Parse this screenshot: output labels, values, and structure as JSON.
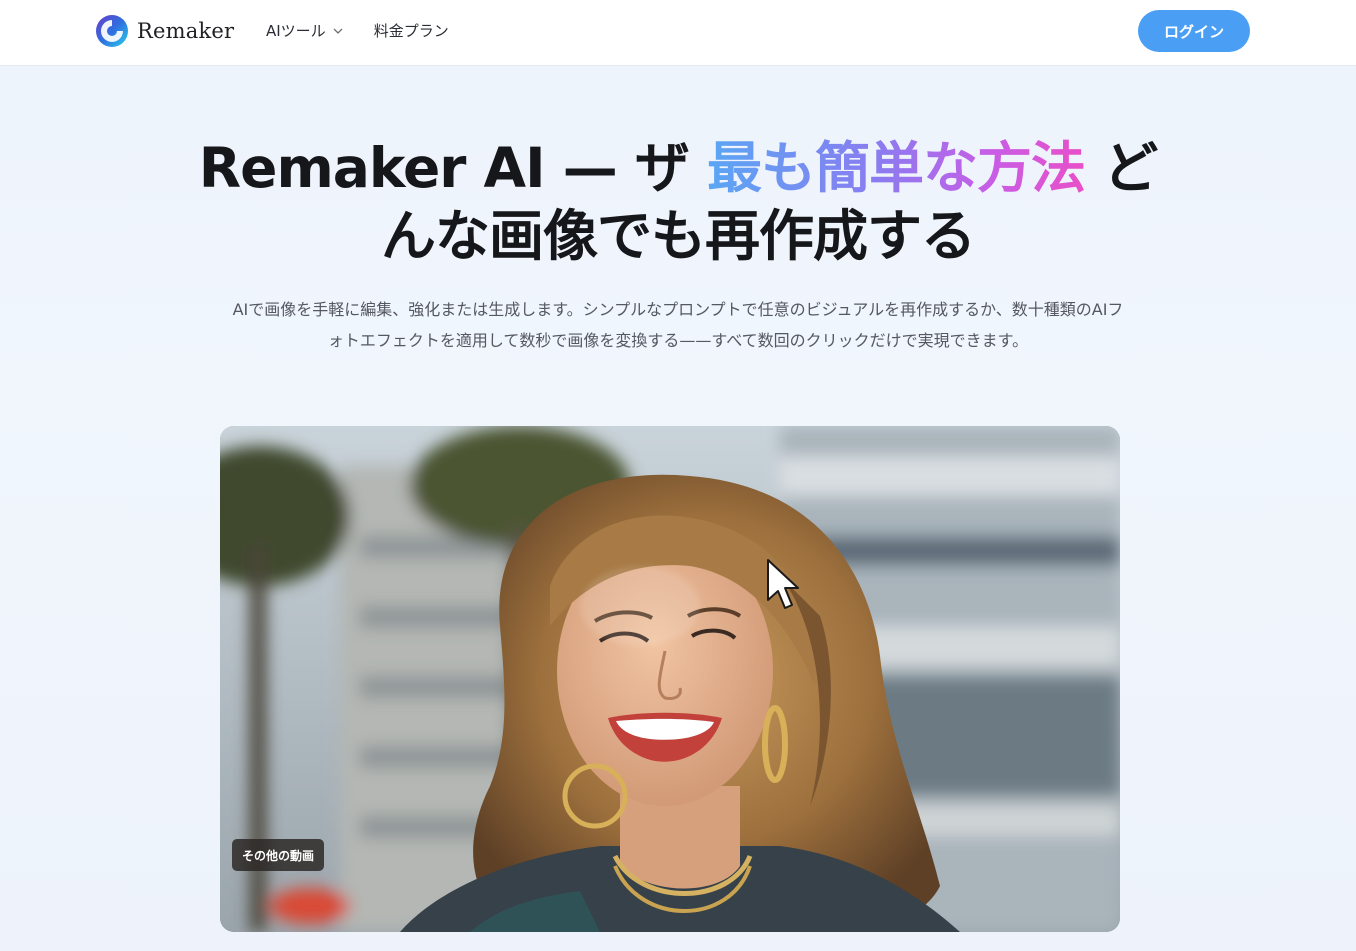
{
  "header": {
    "brand": "Remaker",
    "nav": [
      {
        "label": "AIツール",
        "has_dropdown": true
      },
      {
        "label": "料金プラン",
        "has_dropdown": false
      }
    ],
    "login_label": "ログイン"
  },
  "hero": {
    "title_part1": "Remaker AI — ザ ",
    "title_highlight": "最も簡単な方法",
    "title_part2": " どんな画像でも再作成する",
    "description": "AIで画像を手軽に編集、強化または生成します。シンプルなプロンプトで任意のビジュアルを再作成するか、数十種類のAIフォトエフェクトを適用して数秒で画像を変換する——すべて数回のクリックだけで実現できます。"
  },
  "video": {
    "more_label": "その他の動画"
  },
  "colors": {
    "accent": "#4a9ff5",
    "gradient": [
      "#5aa6f4",
      "#8a7cf0",
      "#c85de6",
      "#e94fc8"
    ]
  }
}
